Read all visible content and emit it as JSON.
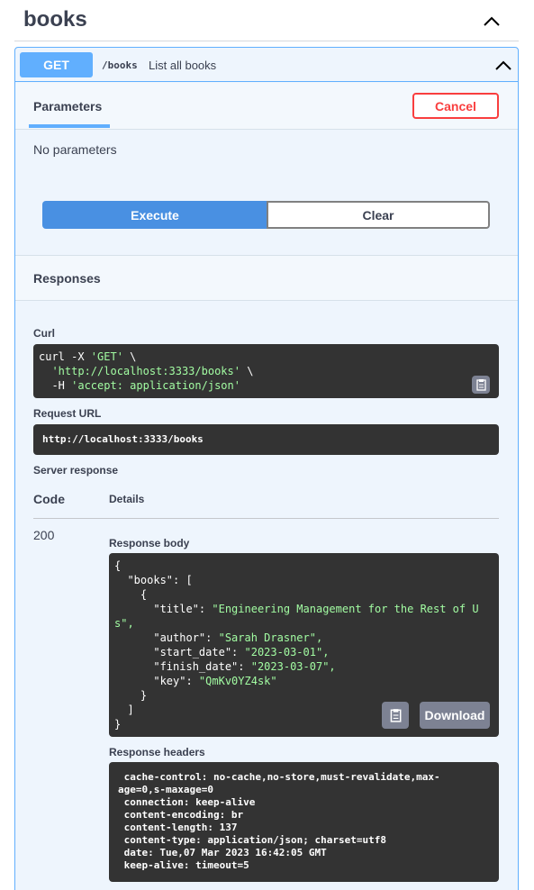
{
  "tag": {
    "title": "books"
  },
  "operation": {
    "method": "GET",
    "path": "/books",
    "description": "List all books"
  },
  "parameters": {
    "tab_label": "Parameters",
    "cancel_label": "Cancel",
    "empty_text": "No parameters"
  },
  "actions": {
    "execute_label": "Execute",
    "clear_label": "Clear"
  },
  "responses": {
    "title": "Responses",
    "curl_label": "Curl",
    "curl_lines": [
      {
        "plain": "curl -X ",
        "str": "'GET'",
        "tail": " \\"
      },
      {
        "plain": "  ",
        "str": "'http://localhost:3333/books'",
        "tail": " \\"
      },
      {
        "plain": "  -H ",
        "str": "'accept: application/json'",
        "tail": ""
      }
    ],
    "request_url_label": "Request URL",
    "request_url": "http://localhost:3333/books",
    "server_response_label": "Server response",
    "code_header": "Code",
    "details_header": "Details",
    "status_code": "200",
    "body_label": "Response body",
    "body_lines": [
      {
        "k": "{",
        "s": ""
      },
      {
        "k": "  \"books\": [",
        "s": ""
      },
      {
        "k": "    {",
        "s": ""
      },
      {
        "k": "      \"title\": ",
        "s": "\"Engineering Management for the Rest of U"
      },
      {
        "k": "",
        "s": "s\","
      },
      {
        "k": "      \"author\": ",
        "s": "\"Sarah Drasner\","
      },
      {
        "k": "      \"start_date\": ",
        "s": "\"2023-03-01\","
      },
      {
        "k": "      \"finish_date\": ",
        "s": "\"2023-03-07\","
      },
      {
        "k": "      \"key\": ",
        "s": "\"QmKv0YZ4sk\""
      },
      {
        "k": "    }",
        "s": ""
      },
      {
        "k": "  ]",
        "s": ""
      },
      {
        "k": "}",
        "s": ""
      }
    ],
    "download_label": "Download",
    "headers_label": "Response headers",
    "header_lines": [
      " cache-control: no-cache,no-store,must-revalidate,max-",
      "age=0,s-maxage=0",
      " connection: keep-alive",
      " content-encoding: br",
      " content-length: 137",
      " content-type: application/json; charset=utf8",
      " date: Tue,07 Mar 2023 16:42:05 GMT",
      " keep-alive: timeout=5"
    ]
  },
  "icons": {
    "collapse": "chevron-up-icon",
    "copy": "clipboard-icon"
  },
  "colors": {
    "get_method": "#61affe",
    "cancel": "#f93e3e",
    "execute": "#4990e2",
    "code_bg": "#333333",
    "code_string": "#a2fca2"
  }
}
